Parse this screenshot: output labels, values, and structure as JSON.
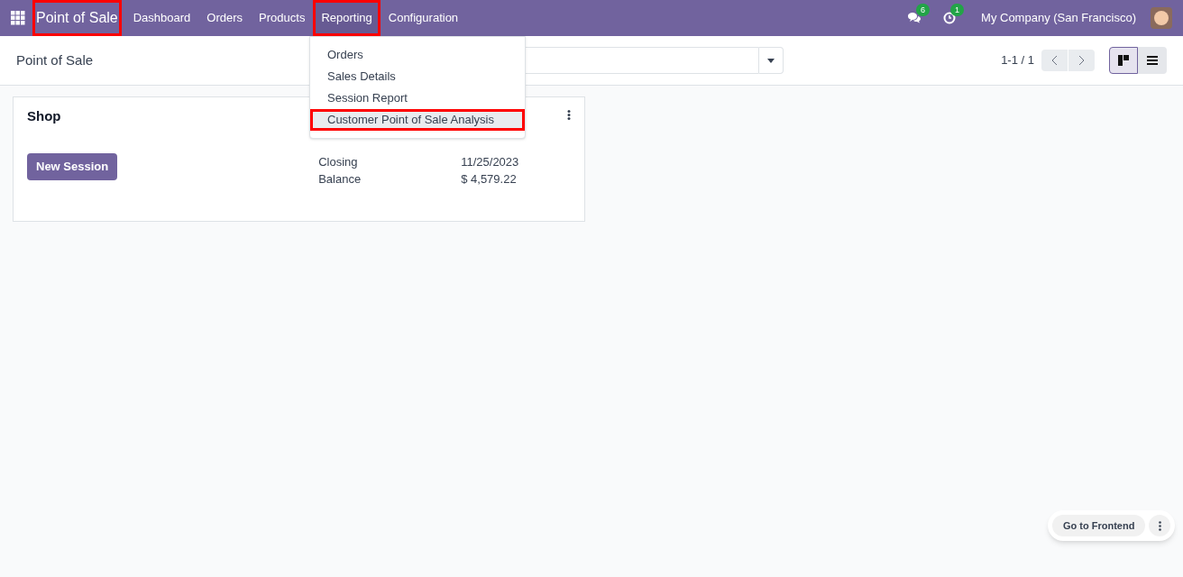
{
  "navbar": {
    "app_name": {
      "label": "Point of Sale",
      "highlighted": true
    },
    "menu": [
      {
        "label": "Dashboard",
        "highlighted": false
      },
      {
        "label": "Orders",
        "highlighted": false
      },
      {
        "label": "Products",
        "highlighted": false
      },
      {
        "label": "Reporting",
        "highlighted": true
      },
      {
        "label": "Configuration",
        "highlighted": false
      }
    ],
    "messages_badge": "6",
    "activities_badge": "1",
    "company": "My Company (San Francisco)"
  },
  "dropdown": [
    {
      "label": "Orders",
      "selected": false,
      "highlighted": false
    },
    {
      "label": "Sales Details",
      "selected": false,
      "highlighted": false
    },
    {
      "label": "Session Report",
      "selected": false,
      "highlighted": false
    },
    {
      "label": "Customer Point of Sale Analysis",
      "selected": true,
      "highlighted": true
    }
  ],
  "control_panel": {
    "breadcrumb": "Point of Sale",
    "pager": "1-1 / 1",
    "views": [
      {
        "kind": "kanban",
        "selected": true
      },
      {
        "kind": "list",
        "selected": false
      }
    ]
  },
  "card": {
    "title": "Shop",
    "button": "New Session",
    "details": [
      {
        "label": "Closing",
        "value": "11/25/2023"
      },
      {
        "label": "Balance",
        "value": "$ 4,579.22"
      }
    ]
  },
  "floating": {
    "button": "Go to Frontend"
  }
}
